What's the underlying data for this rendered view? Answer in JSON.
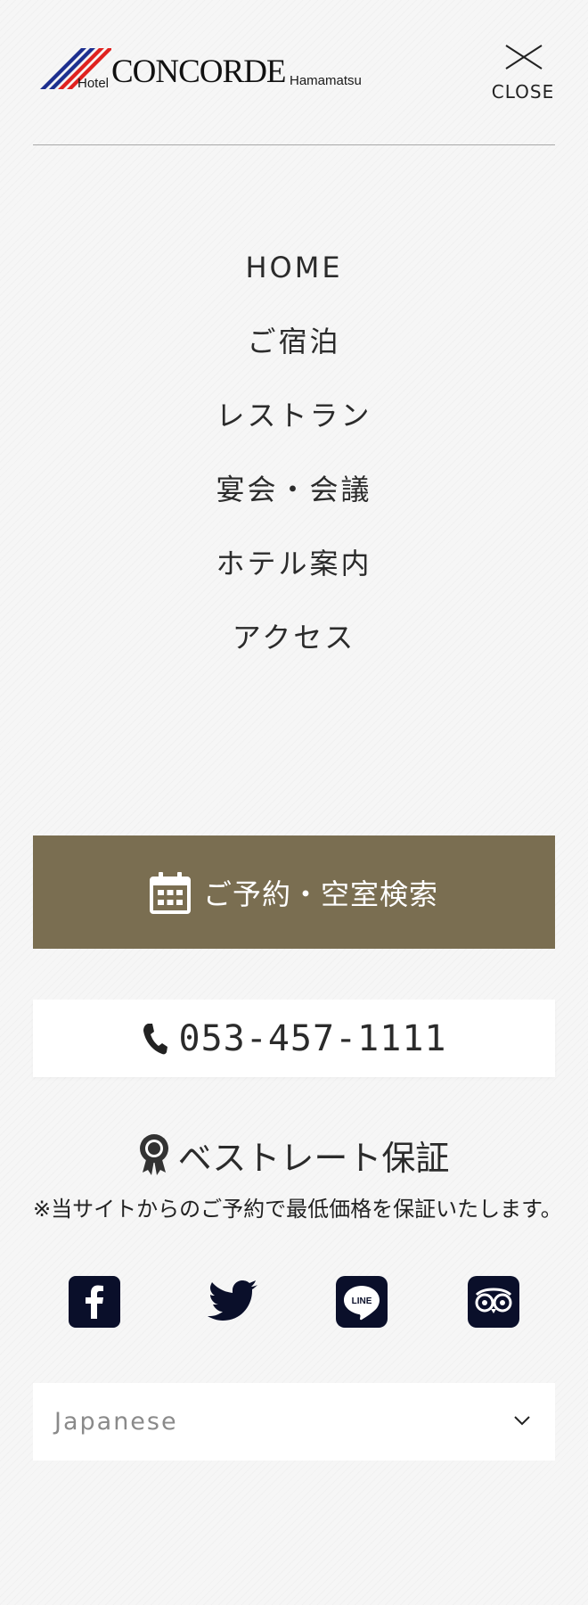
{
  "logo": {
    "hotel": "Hotel",
    "name": "CONCORDE",
    "city": "Hamamatsu"
  },
  "close": {
    "label": "CLOSE"
  },
  "nav": {
    "items": [
      {
        "label": "HOME"
      },
      {
        "label": "ご宿泊"
      },
      {
        "label": "レストラン"
      },
      {
        "label": "宴会・会議"
      },
      {
        "label": "ホテル案内"
      },
      {
        "label": "アクセス"
      }
    ]
  },
  "reserve": {
    "label": "ご予約・空室検索",
    "icon": "calendar-icon",
    "bg_color": "#7a6e51"
  },
  "phone": {
    "number": "053-457-1111",
    "icon": "phone-icon"
  },
  "best_rate": {
    "title": "ベストレート保証",
    "note": "※当サイトからのご予約で最低価格を保証いたします。",
    "icon": "award-badge-icon"
  },
  "social": [
    {
      "name": "facebook",
      "icon": "facebook-icon"
    },
    {
      "name": "twitter",
      "icon": "twitter-icon"
    },
    {
      "name": "line",
      "icon": "line-icon"
    },
    {
      "name": "tripadvisor",
      "icon": "tripadvisor-icon"
    }
  ],
  "language": {
    "selected": "Japanese"
  },
  "colors": {
    "brand_red": "#e0221f",
    "brand_blue": "#1d2f8f",
    "text": "#2b2b2b",
    "icon_dark": "#0a0f2a"
  }
}
